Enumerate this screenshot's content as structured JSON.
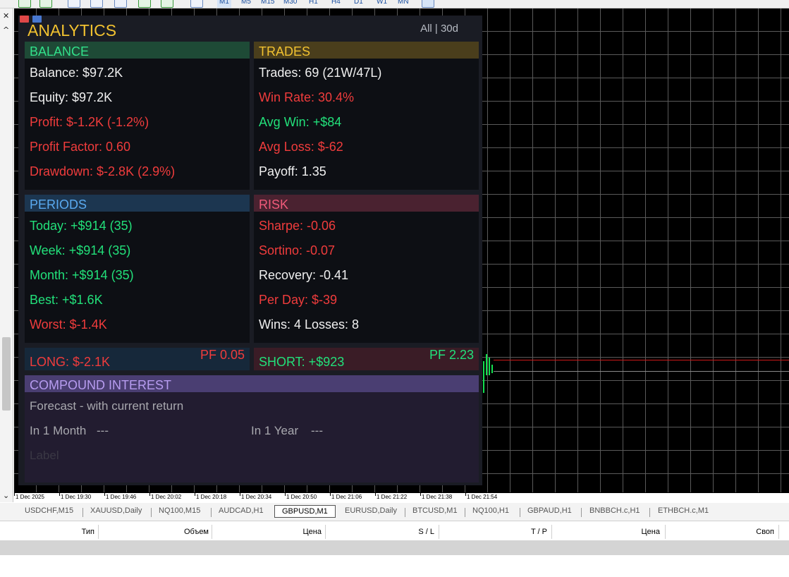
{
  "toolbar": {
    "timeframes": [
      "M1",
      "M5",
      "M15",
      "M30",
      "H1",
      "H4",
      "D1",
      "W1",
      "MN"
    ]
  },
  "analytics": {
    "title": "ANALYTICS",
    "range": "All | 30d",
    "balance": {
      "title": "BALANCE",
      "rows": [
        "Balance: $97.2K",
        "Equity: $97.2K",
        "Profit: $-1.2K (-1.2%)",
        "Profit Factor: 0.60",
        "Drawdown: $-2.8K (2.9%)"
      ]
    },
    "trades": {
      "title": "TRADES",
      "rows": [
        "Trades: 69 (21W/47L)",
        "Win Rate: 30.4%",
        "Avg Win: +$84",
        "Avg Loss: $-62",
        "Payoff: 1.35"
      ]
    },
    "periods": {
      "title": "PERIODS",
      "rows": [
        "Today: +$914 (35)",
        "Week: +$914 (35)",
        "Month: +$914 (35)",
        "Best: +$1.6K",
        "Worst: $-1.4K"
      ]
    },
    "risk": {
      "title": "RISK",
      "rows": [
        "Sharpe: -0.06",
        "Sortino: -0.07",
        "Recovery: -0.41",
        "Per Day: $-39",
        "Wins: 4  Losses: 8"
      ]
    },
    "long": {
      "label": "LONG: $-2.1K",
      "pf": "PF 0.05"
    },
    "short": {
      "label": "SHORT: +$923",
      "pf": "PF 2.23"
    },
    "compound": {
      "title": "COMPOUND INTEREST",
      "forecast": "Forecast - with current return",
      "month": "In 1 Month",
      "month_value": "---",
      "year": "In 1 Year",
      "year_value": "---",
      "label": "Label"
    }
  },
  "time_axis": [
    "1 Dec 2025",
    "1 Dec 19:30",
    "1 Dec 19:46",
    "1 Dec 20:02",
    "1 Dec 20:18",
    "1 Dec 20:34",
    "1 Dec 20:50",
    "1 Dec 21:06",
    "1 Dec 21:22",
    "1 Dec 21:38",
    "1 Dec 21:54"
  ],
  "symbol_tabs": [
    "USDCHF,M15",
    "XAUUSD,Daily",
    "NQ100,M15",
    "AUDCAD,H1",
    "GBPUSD,M1",
    "EURUSD,Daily",
    "BTCUSD,M1",
    "NQ100,H1",
    "GBPAUD,H1",
    "BNBBCH.c,H1",
    "ETHBCH.c,M1"
  ],
  "active_symbol": "GBPUSD,M1",
  "table_headers": [
    "Тип",
    "Объем",
    "Цена",
    "S / L",
    "T / P",
    "Цена",
    "Своп"
  ],
  "colors": {
    "title": "#f2c230",
    "positive": "#22e07a",
    "negative": "#f03c3c",
    "neutral": "#f0f0f0",
    "balance_head": "#1e4a36",
    "trades_head": "#4a3e1c",
    "periods_head": "#1c3650",
    "risk_head": "#4a2230",
    "compound_head": "#4a3e72"
  }
}
